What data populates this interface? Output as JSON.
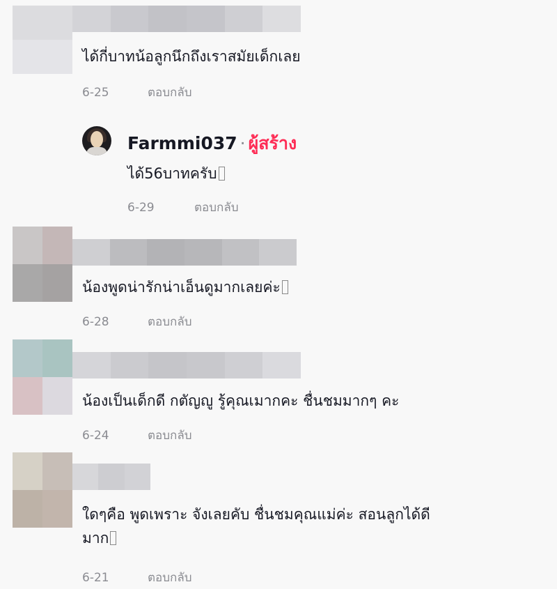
{
  "comments": [
    {
      "text": "ได้กี่บาทน้อลูกนึกถึงเราสมัยเด็กเลย",
      "text2": "",
      "date": "6-25",
      "reply_label": "ตอบกลับ",
      "has_tofu": false,
      "avatar_colors": [
        "#dcdcdf",
        "#dcdcdf",
        "#e4e4e8",
        "#e4e4e8"
      ],
      "name_colors": [
        "#d3d3d7",
        "#c9c9ce",
        "#c2c2c7",
        "#c5c5ca",
        "#cfcfd3",
        "#dddde0"
      ]
    },
    {
      "text": "น้องพูดน่ารักน่าเอ็นดูมากเลยค่ะ",
      "text2": "",
      "date": "6-28",
      "reply_label": "ตอบกลับ",
      "has_tofu": true,
      "avatar_colors": [
        "#c9c6c6",
        "#c4b7b7",
        "#a9a8a8",
        "#a5a2a2"
      ],
      "name_colors": [
        "#cfcfd2",
        "#bcbcbf",
        "#b3b3b6",
        "#b7b7ba",
        "#c1c1c4",
        "#cbcbce"
      ]
    },
    {
      "text": "น้องเป็นเด็กดี กตัญญู รู้คุณเมากคะ ชื่นชมมากๆ คะ",
      "text2": "",
      "date": "6-24",
      "reply_label": "ตอบกลับ",
      "has_tofu": false,
      "avatar_colors": [
        "#b3c8c9",
        "#a9c4c1",
        "#d8c1c4",
        "#dcd9df"
      ],
      "name_colors": [
        "#d5d5d9",
        "#cbcbcf",
        "#c5c5c9",
        "#c8c8cc",
        "#cfcfd3",
        "#dadade"
      ]
    },
    {
      "text": "ใดๆคือ พูดเพราะ จังเลยคับ ชื่นชมคุณแม่ค่ะ สอนลูกได้ดี",
      "text2": "มาก",
      "date": "6-21",
      "reply_label": "ตอบกลับ",
      "has_tofu": true,
      "avatar_colors": [
        "#d6d1c6",
        "#c7beb7",
        "#bdb2a7",
        "#c2b5ac"
      ],
      "name_colors": [
        "#d7d7da",
        "#cdcdd1",
        "#d2d2d6"
      ]
    }
  ],
  "reply": {
    "author": "Farmmi037",
    "separator": "·",
    "badge": "ผู้สร้าง",
    "text": "ได้56บาทครับ",
    "date": "6-29",
    "reply_label": "ตอบกลับ",
    "badge_color": "#fe2c55"
  }
}
